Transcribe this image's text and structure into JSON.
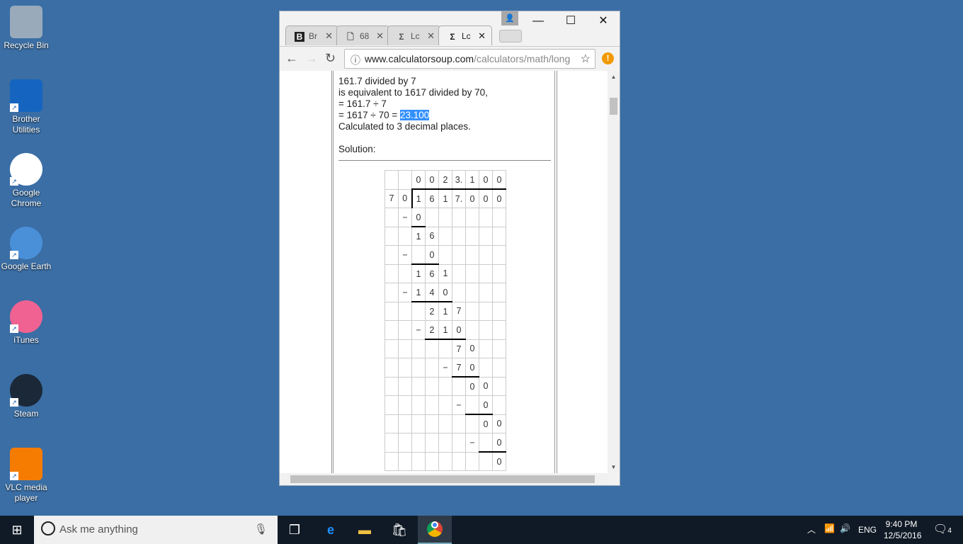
{
  "desktop": {
    "icons": [
      {
        "label": "Recycle Bin",
        "icon": "recycle-bin-icon"
      },
      {
        "label": "Brother Utilities",
        "icon": "brother-utilities-icon"
      },
      {
        "label": "Google Chrome",
        "icon": "chrome-icon"
      },
      {
        "label": "Google Earth",
        "icon": "google-earth-icon"
      },
      {
        "label": "iTunes",
        "icon": "itunes-icon"
      },
      {
        "label": "Steam",
        "icon": "steam-icon"
      },
      {
        "label": "VLC media player",
        "icon": "vlc-icon"
      }
    ]
  },
  "browser": {
    "tabs": [
      {
        "label": "Br",
        "icon": "B"
      },
      {
        "label": "68",
        "icon": "page"
      },
      {
        "label": "Lc",
        "icon": "Σ"
      },
      {
        "label": "Lc",
        "icon": "Σ",
        "active": true
      }
    ],
    "url_host": "www.calculatorsoup.com",
    "url_path": "/calculators/math/long",
    "controls": {
      "minimize": "—",
      "maximize": "☐",
      "close": "✕"
    }
  },
  "page": {
    "lines": [
      "161.7 divided by 7",
      "is equivalent to 1617 divided by 70,",
      "= 161.7 ÷ 7",
      "= 1617 ÷ 70 = "
    ],
    "result": "23.100",
    "precision": "Calculated to 3 decimal places.",
    "solution_label": "Solution:",
    "grid": [
      {
        "cells": [
          "",
          "",
          "0",
          "0",
          "2",
          "3.",
          "1",
          "0",
          "0"
        ]
      },
      {
        "cells": [
          "7",
          "0",
          "1",
          "6",
          "1",
          "7.",
          "0",
          "0",
          "0"
        ]
      },
      {
        "cells": [
          "",
          "−",
          "0",
          "",
          "",
          "",
          "",
          "",
          ""
        ],
        "underline": [
          2,
          2
        ]
      },
      {
        "cells": [
          "",
          "",
          "1",
          "6",
          "",
          "",
          "",
          "",
          ""
        ]
      },
      {
        "cells": [
          "",
          "−",
          "",
          "0",
          "",
          "",
          "",
          "",
          ""
        ],
        "underline": [
          2,
          3
        ]
      },
      {
        "cells": [
          "",
          "",
          "1",
          "6",
          "1",
          "",
          "",
          "",
          ""
        ]
      },
      {
        "cells": [
          "",
          "−",
          "1",
          "4",
          "0",
          "",
          "",
          "",
          ""
        ],
        "underline": [
          2,
          4
        ]
      },
      {
        "cells": [
          "",
          "",
          "",
          "2",
          "1",
          "7",
          "",
          "",
          ""
        ]
      },
      {
        "cells": [
          "",
          "",
          "−",
          "2",
          "1",
          "0",
          "",
          "",
          ""
        ],
        "underline": [
          3,
          5
        ]
      },
      {
        "cells": [
          "",
          "",
          "",
          "",
          "",
          "7",
          "0",
          "",
          ""
        ]
      },
      {
        "cells": [
          "",
          "",
          "",
          "",
          "−",
          "7",
          "0",
          "",
          ""
        ],
        "underline": [
          5,
          6
        ]
      },
      {
        "cells": [
          "",
          "",
          "",
          "",
          "",
          "",
          "0",
          "0",
          ""
        ]
      },
      {
        "cells": [
          "",
          "",
          "",
          "",
          "",
          "−",
          "",
          "0",
          ""
        ],
        "underline": [
          6,
          7
        ]
      },
      {
        "cells": [
          "",
          "",
          "",
          "",
          "",
          "",
          "",
          "0",
          "0"
        ]
      },
      {
        "cells": [
          "",
          "",
          "",
          "",
          "",
          "",
          "−",
          "",
          "0"
        ],
        "underline": [
          7,
          8
        ]
      },
      {
        "cells": [
          "",
          "",
          "",
          "",
          "",
          "",
          "",
          "",
          "0"
        ]
      }
    ]
  },
  "taskbar": {
    "search_placeholder": "Ask me anything",
    "language": "ENG",
    "time": "9:40 PM",
    "date": "12/5/2016",
    "notifications": "4"
  }
}
